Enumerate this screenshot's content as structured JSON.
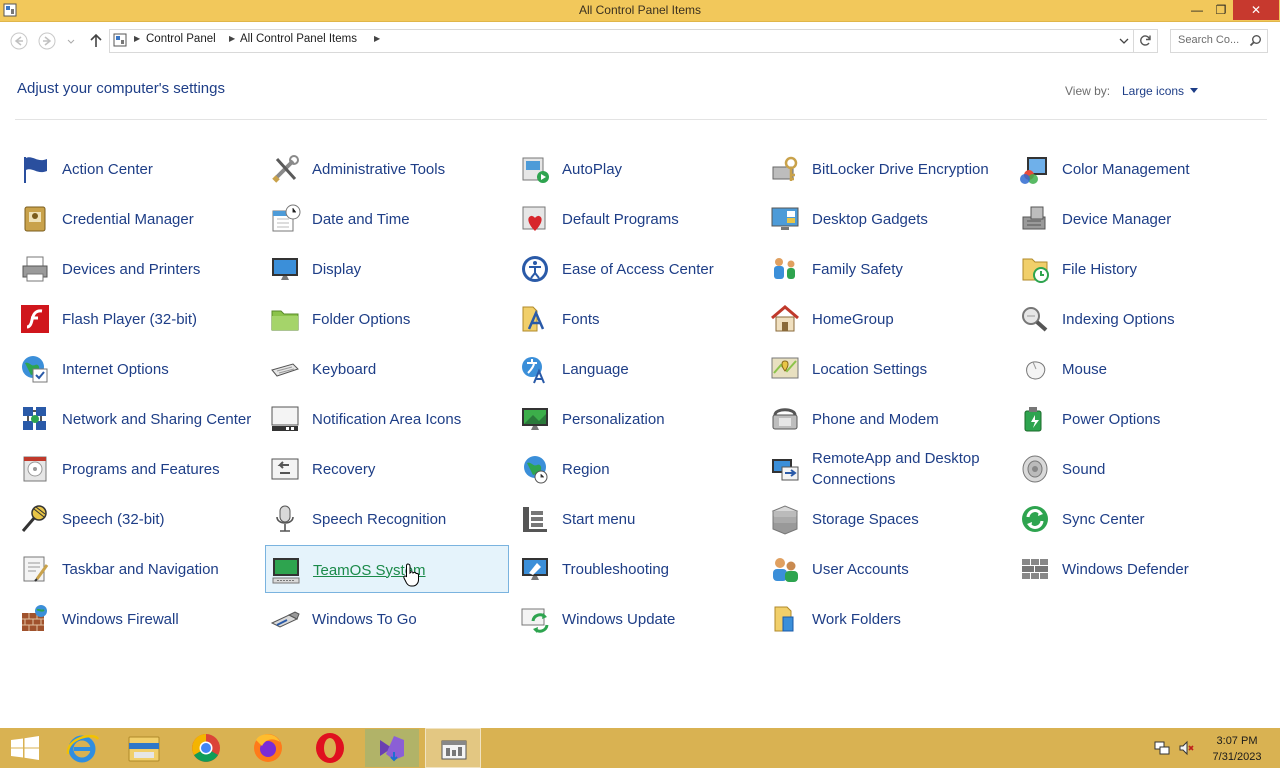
{
  "window": {
    "title": "All Control Panel Items"
  },
  "address": {
    "crumbs": [
      "Control Panel",
      "All Control Panel Items"
    ],
    "search_placeholder": "Search Co..."
  },
  "header": {
    "heading": "Adjust your computer's settings",
    "view_by_label": "View by:",
    "view_by_value": "Large icons"
  },
  "items": [
    {
      "label": "Action Center",
      "icon": "flag-icon"
    },
    {
      "label": "Administrative Tools",
      "icon": "tools-icon"
    },
    {
      "label": "AutoPlay",
      "icon": "autoplay-icon"
    },
    {
      "label": "BitLocker Drive Encryption",
      "icon": "bitlocker-icon"
    },
    {
      "label": "Color Management",
      "icon": "color-management-icon"
    },
    {
      "label": "Credential Manager",
      "icon": "credential-icon"
    },
    {
      "label": "Date and Time",
      "icon": "calendar-clock-icon"
    },
    {
      "label": "Default Programs",
      "icon": "default-programs-icon"
    },
    {
      "label": "Desktop Gadgets",
      "icon": "gadgets-icon"
    },
    {
      "label": "Device Manager",
      "icon": "device-manager-icon"
    },
    {
      "label": "Devices and Printers",
      "icon": "printer-icon"
    },
    {
      "label": "Display",
      "icon": "monitor-icon"
    },
    {
      "label": "Ease of Access Center",
      "icon": "ease-of-access-icon"
    },
    {
      "label": "Family Safety",
      "icon": "family-icon"
    },
    {
      "label": "File History",
      "icon": "file-history-icon"
    },
    {
      "label": "Flash Player (32-bit)",
      "icon": "flash-icon"
    },
    {
      "label": "Folder Options",
      "icon": "folder-icon"
    },
    {
      "label": "Fonts",
      "icon": "fonts-icon"
    },
    {
      "label": "HomeGroup",
      "icon": "home-icon"
    },
    {
      "label": "Indexing Options",
      "icon": "indexing-icon"
    },
    {
      "label": "Internet Options",
      "icon": "globe-icon"
    },
    {
      "label": "Keyboard",
      "icon": "keyboard-icon"
    },
    {
      "label": "Language",
      "icon": "language-icon"
    },
    {
      "label": "Location Settings",
      "icon": "location-icon"
    },
    {
      "label": "Mouse",
      "icon": "mouse-icon"
    },
    {
      "label": "Network and Sharing Center",
      "icon": "network-icon"
    },
    {
      "label": "Notification Area Icons",
      "icon": "notification-icon"
    },
    {
      "label": "Personalization",
      "icon": "personalization-icon"
    },
    {
      "label": "Phone and Modem",
      "icon": "phone-icon"
    },
    {
      "label": "Power Options",
      "icon": "power-icon"
    },
    {
      "label": "Programs and Features",
      "icon": "programs-icon"
    },
    {
      "label": "Recovery",
      "icon": "recovery-icon"
    },
    {
      "label": "Region",
      "icon": "region-icon"
    },
    {
      "label": "RemoteApp and Desktop Connections",
      "icon": "remoteapp-icon"
    },
    {
      "label": "Sound",
      "icon": "speaker-icon"
    },
    {
      "label": "Speech (32-bit)",
      "icon": "speech-icon"
    },
    {
      "label": "Speech Recognition",
      "icon": "microphone-icon"
    },
    {
      "label": "Start menu",
      "icon": "start-menu-icon"
    },
    {
      "label": "Storage Spaces",
      "icon": "storage-icon"
    },
    {
      "label": "Sync Center",
      "icon": "sync-icon"
    },
    {
      "label": "Taskbar and Navigation",
      "icon": "taskbar-icon"
    },
    {
      "label": "TeamOS System",
      "icon": "computer-icon"
    },
    {
      "label": "Troubleshooting",
      "icon": "troubleshooting-icon"
    },
    {
      "label": "User Accounts",
      "icon": "users-icon"
    },
    {
      "label": "Windows Defender",
      "icon": "defender-icon"
    },
    {
      "label": "Windows Firewall",
      "icon": "firewall-icon"
    },
    {
      "label": "Windows To Go",
      "icon": "usb-icon"
    },
    {
      "label": "Windows Update",
      "icon": "update-icon"
    },
    {
      "label": "Work Folders",
      "icon": "work-folders-icon"
    }
  ],
  "selected_item": "TeamOS System",
  "taskbar": {
    "apps": [
      "start-icon",
      "internet-explorer-icon",
      "file-explorer-icon",
      "chrome-icon",
      "firefox-icon",
      "opera-icon",
      "visual-studio-icon",
      "control-panel-icon"
    ],
    "active_app": "control-panel-icon",
    "time": "3:07 PM",
    "date": "7/31/2023"
  },
  "colors": {
    "titlebar": "#f2c85b",
    "taskbar": "#d9b252",
    "link": "#1e3e87",
    "selected_bg": "#e5f3fb"
  }
}
